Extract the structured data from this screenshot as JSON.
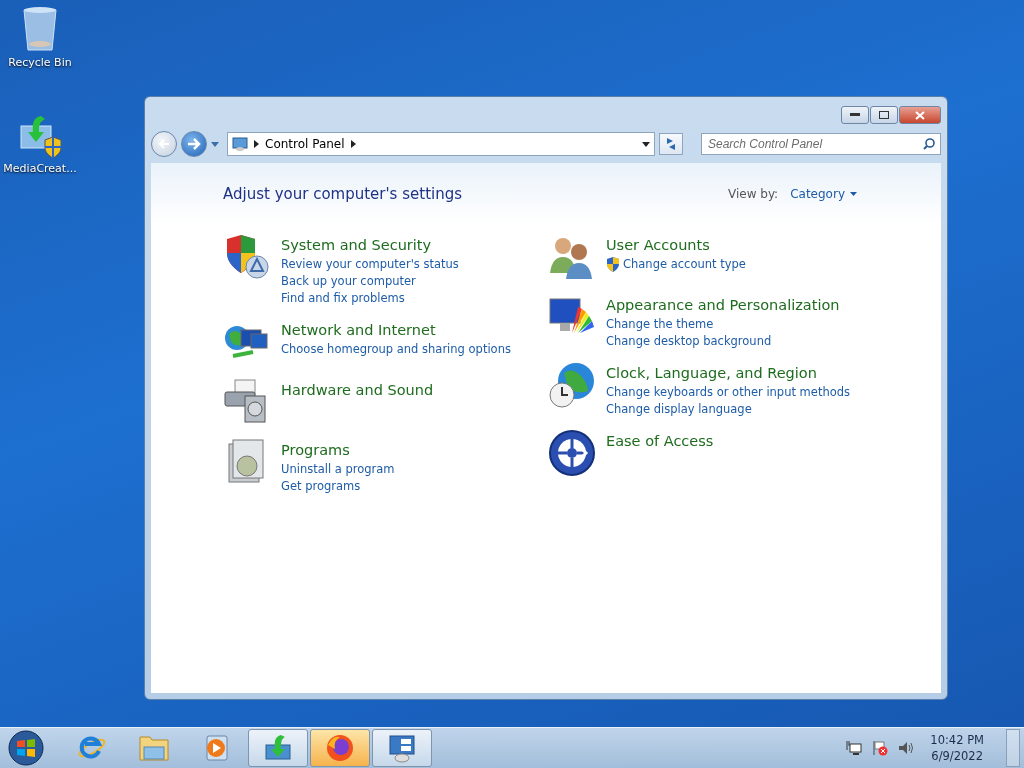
{
  "desktop_icons": [
    {
      "label": "Recycle Bin"
    },
    {
      "label": "MediaCreat..."
    }
  ],
  "window": {
    "breadcrumb": "Control Panel",
    "search": {
      "placeholder": "Search Control Panel"
    },
    "heading": "Adjust your computer's settings",
    "view_by": {
      "label": "View by:",
      "value": "Category"
    },
    "columns": [
      [
        {
          "title": "System and Security",
          "links": [
            {
              "text": "Review your computer's status",
              "kind": "plain"
            },
            {
              "text": "Back up your computer",
              "kind": "plain"
            },
            {
              "text": "Find and fix problems",
              "kind": "plain"
            }
          ]
        },
        {
          "title": "Network and Internet",
          "links": [
            {
              "text": "Choose homegroup and sharing options",
              "kind": "plain"
            }
          ]
        },
        {
          "title": "Hardware and Sound"
        },
        {
          "title": "Programs",
          "links": [
            {
              "text": "Uninstall a program",
              "kind": "plain"
            },
            {
              "text": "Get programs",
              "kind": "plain"
            }
          ]
        }
      ],
      [
        {
          "title": "User Accounts",
          "links": [
            {
              "text": "Change account type",
              "kind": "admin"
            }
          ]
        },
        {
          "title": "Appearance and Personalization",
          "links": [
            {
              "text": "Change the theme",
              "kind": "plain"
            },
            {
              "text": "Change desktop background",
              "kind": "plain"
            }
          ]
        },
        {
          "title": "Clock, Language, and Region",
          "links": [
            {
              "text": "Change keyboards or other input methods",
              "kind": "plain"
            },
            {
              "text": "Change display language",
              "kind": "plain"
            }
          ]
        },
        {
          "title": "Ease of Access"
        }
      ]
    ]
  },
  "taskbar": {
    "items": [
      {
        "running": false,
        "selected": false
      },
      {
        "running": false,
        "selected": false
      },
      {
        "running": false,
        "selected": false
      },
      {
        "running": true,
        "selected": false
      },
      {
        "running": true,
        "selected": true
      },
      {
        "running": true,
        "selected": false
      }
    ],
    "clock": {
      "time": "10:42 PM",
      "date": "6/9/2022"
    }
  }
}
